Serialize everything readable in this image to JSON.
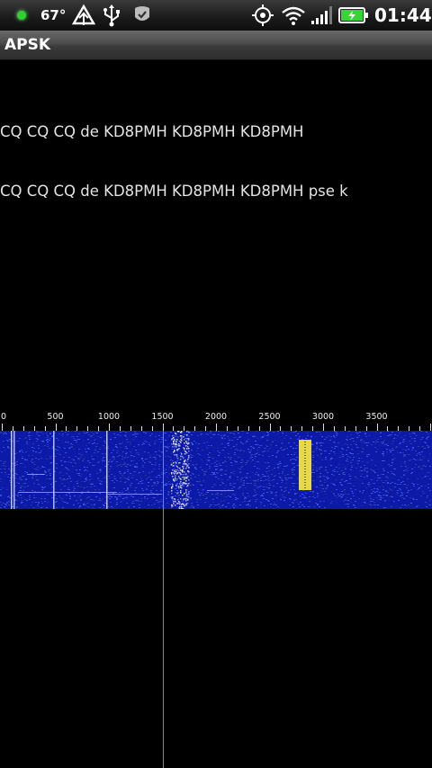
{
  "status_bar": {
    "temperature": "67°",
    "time": "01:44",
    "icons": [
      "notification-dot-icon",
      "weather-icon",
      "usb-icon",
      "check-shield-icon",
      "gps-icon",
      "wifi-icon",
      "signal-icon",
      "battery-icon"
    ]
  },
  "app": {
    "title": "APSK"
  },
  "received_text": {
    "lines": [
      "CQ CQ CQ de KD8PMH KD8PMH KD8PMH",
      "CQ CQ CQ de KD8PMH KD8PMH KD8PMH pse k"
    ]
  },
  "waterfall": {
    "scale_labels": [
      "0",
      "500",
      "1000",
      "1500",
      "2000",
      "2500",
      "3000",
      "3500"
    ],
    "scale_max_hz": 4000,
    "cursor_hz": 1500,
    "colors": {
      "background": "#0d1aa8",
      "signal": "#e6d84a",
      "cursor": "#1fd11f"
    }
  }
}
